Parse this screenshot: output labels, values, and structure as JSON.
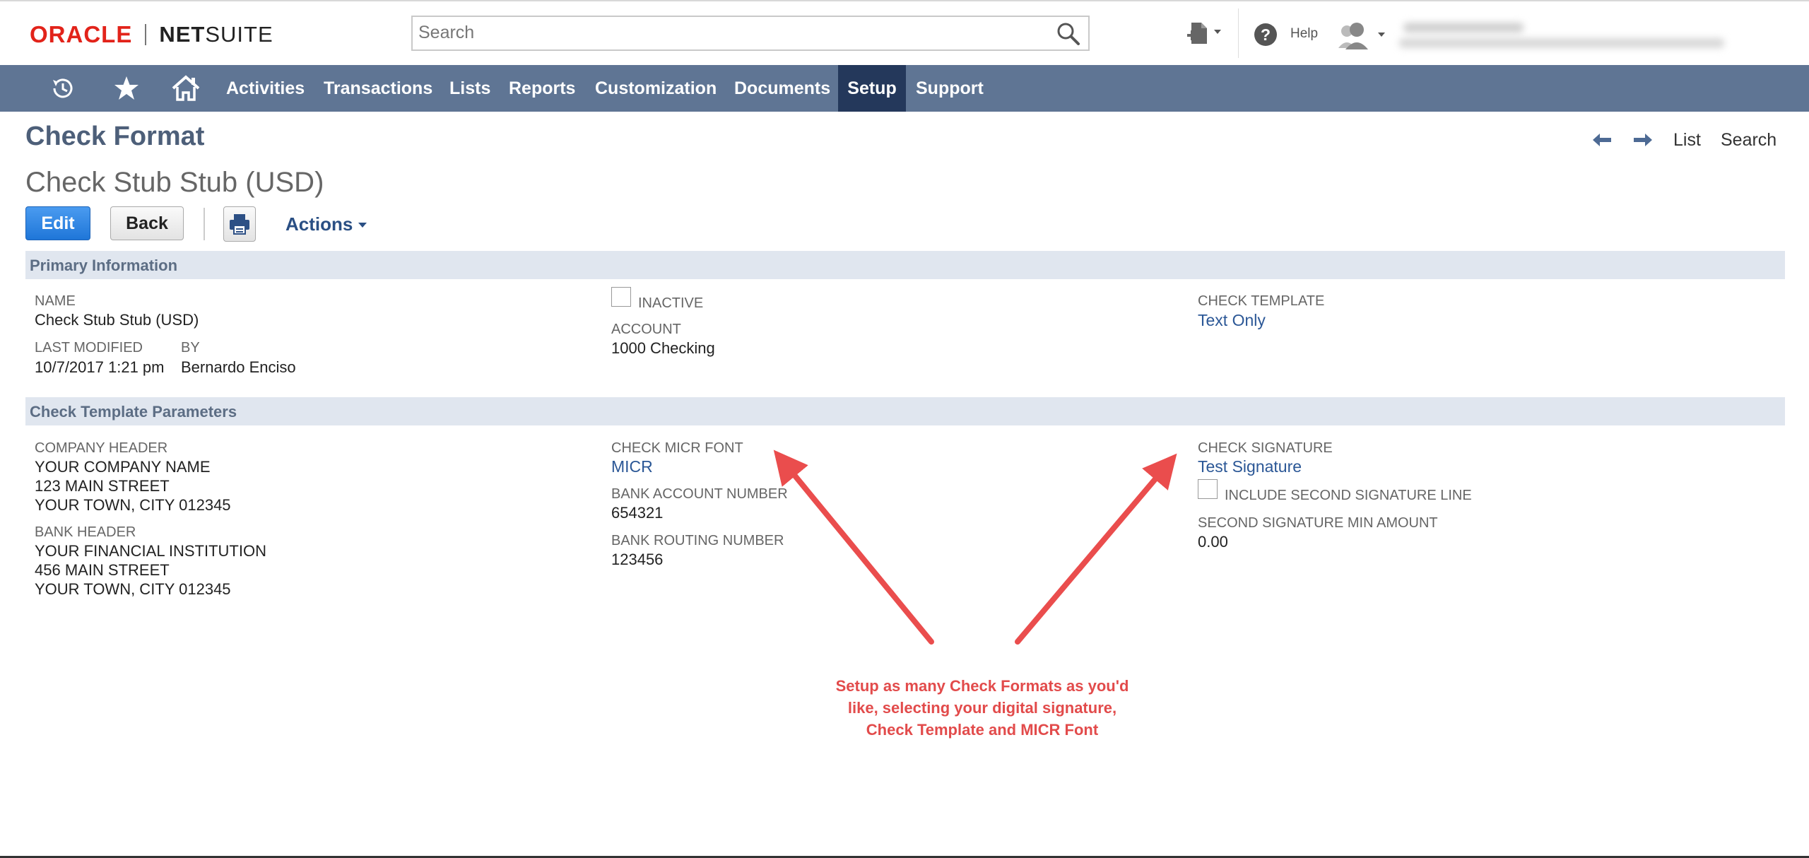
{
  "header": {
    "logo_left": "ORACLE",
    "logo_right_bold": "NET",
    "logo_right": "SUITE",
    "search_placeholder": "Search",
    "help_label": "Help"
  },
  "nav": {
    "items": [
      {
        "label": "Activities"
      },
      {
        "label": "Transactions"
      },
      {
        "label": "Lists"
      },
      {
        "label": "Reports"
      },
      {
        "label": "Customization"
      },
      {
        "label": "Documents"
      },
      {
        "label": "Setup",
        "active": true
      },
      {
        "label": "Support"
      }
    ]
  },
  "page": {
    "title": "Check Format",
    "record_title": "Check Stub Stub (USD)",
    "list_link": "List",
    "search_link": "Search"
  },
  "toolbar": {
    "edit_label": "Edit",
    "back_label": "Back",
    "actions_label": "Actions"
  },
  "primary": {
    "section_label": "Primary Information",
    "name_label": "NAME",
    "name_value": "Check Stub Stub (USD)",
    "last_modified_label": "LAST MODIFIED",
    "last_modified_value": "10/7/2017 1:21 pm",
    "by_label": "BY",
    "by_value": "Bernardo Enciso",
    "inactive_label": "INACTIVE",
    "account_label": "ACCOUNT",
    "account_value": "1000 Checking",
    "check_template_label": "CHECK TEMPLATE",
    "check_template_value": "Text Only"
  },
  "params": {
    "section_label": "Check Template Parameters",
    "company_header_label": "COMPANY HEADER",
    "company_header_lines": [
      "YOUR COMPANY NAME",
      "123 MAIN STREET",
      "YOUR TOWN, CITY 012345"
    ],
    "bank_header_label": "BANK HEADER",
    "bank_header_lines": [
      "YOUR FINANCIAL INSTITUTION",
      "456 MAIN STREET",
      "YOUR TOWN, CITY 012345"
    ],
    "micr_font_label": "CHECK MICR FONT",
    "micr_font_value": "MICR",
    "bank_account_label": "BANK ACCOUNT NUMBER",
    "bank_account_value": "654321",
    "routing_label": "BANK ROUTING NUMBER",
    "routing_value": "123456",
    "signature_label": "CHECK SIGNATURE",
    "signature_value": "Test Signature",
    "second_sig_label": "INCLUDE SECOND SIGNATURE LINE",
    "second_sig_min_label": "SECOND SIGNATURE MIN AMOUNT",
    "second_sig_min_value": "0.00"
  },
  "annotation": {
    "lines": [
      "Setup as many Check Formats as you'd",
      "like, selecting your digital signature,",
      "Check Template and MICR Font"
    ]
  },
  "colors": {
    "nav_bg": "#5f7594",
    "nav_active": "#24385b",
    "link": "#2b5796",
    "annotation": "#e24b4b",
    "oracle_red": "#e2231a"
  }
}
